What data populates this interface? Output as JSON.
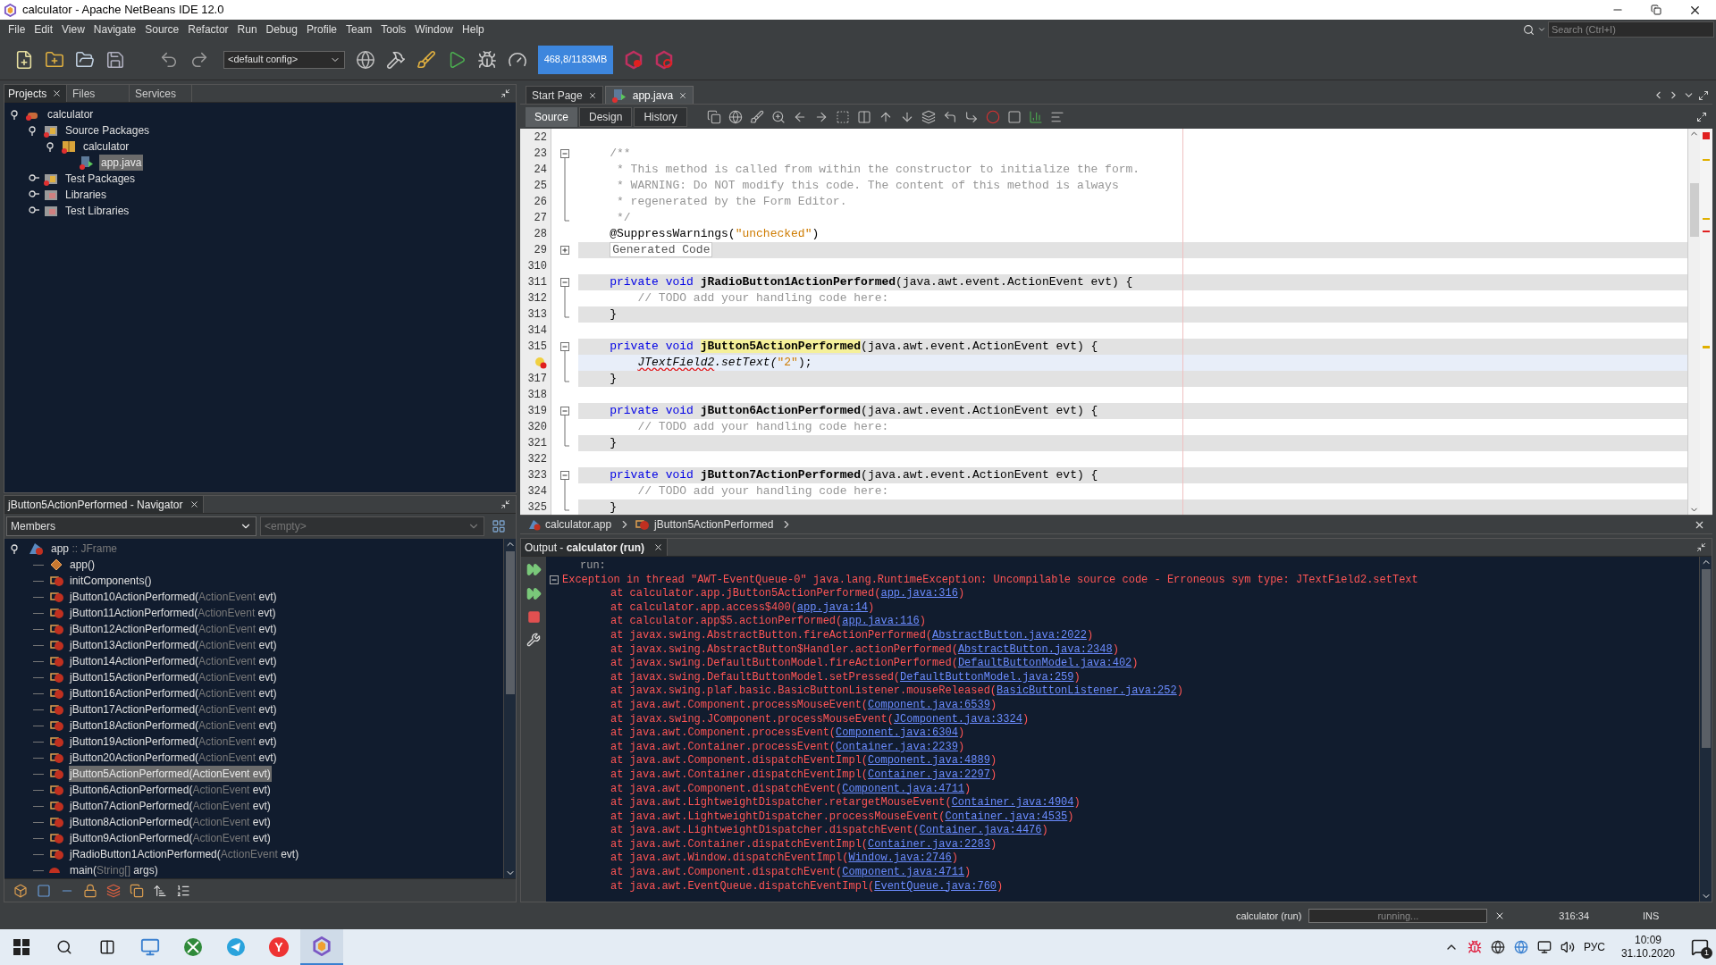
{
  "window": {
    "title": "calculator - Apache NetBeans IDE 12.0"
  },
  "menu": [
    "File",
    "Edit",
    "View",
    "Navigate",
    "Source",
    "Refactor",
    "Run",
    "Debug",
    "Profile",
    "Team",
    "Tools",
    "Window",
    "Help"
  ],
  "search": {
    "placeholder": "Search (Ctrl+I)"
  },
  "toolbar": {
    "config": "<default config>",
    "memory": "468,8/1183MB"
  },
  "projects_panel": {
    "tabs": [
      {
        "label": "Projects",
        "selected": true
      },
      {
        "label": "Files",
        "selected": false
      },
      {
        "label": "Services",
        "selected": false
      }
    ],
    "tree": [
      {
        "label": "calculator",
        "kind": "project",
        "expanded": true,
        "selected": false,
        "children": [
          {
            "label": "Source Packages",
            "kind": "sources",
            "expanded": true,
            "selected": false,
            "children": [
              {
                "label": "calculator",
                "kind": "package",
                "expanded": true,
                "selected": false,
                "children": [
                  {
                    "label": "app.java",
                    "kind": "file",
                    "selected": true
                  }
                ]
              }
            ]
          },
          {
            "label": "Test Packages",
            "kind": "sources",
            "expanded": false,
            "selected": false
          },
          {
            "label": "Libraries",
            "kind": "library",
            "expanded": false,
            "selected": false
          },
          {
            "label": "Test Libraries",
            "kind": "library",
            "expanded": false,
            "selected": false
          }
        ]
      }
    ]
  },
  "navigator": {
    "title": "jButton5ActionPerformed - Navigator",
    "filter": "Members",
    "filter_2": "<empty>",
    "root": {
      "name": "app",
      "type": ":: JFrame",
      "expanded": true,
      "selected": false,
      "children": [
        {
          "kind": "constructor",
          "name": "app()",
          "selected": false
        },
        {
          "kind": "method",
          "name": "initComponents()",
          "selected": false
        },
        {
          "kind": "method",
          "name": "jButton10ActionPerformed(",
          "type": "ActionEvent",
          "tail": " evt)",
          "selected": false
        },
        {
          "kind": "method",
          "name": "jButton11ActionPerformed(",
          "type": "ActionEvent",
          "tail": " evt)",
          "selected": false
        },
        {
          "kind": "method",
          "name": "jButton12ActionPerformed(",
          "type": "ActionEvent",
          "tail": " evt)",
          "selected": false
        },
        {
          "kind": "method",
          "name": "jButton13ActionPerformed(",
          "type": "ActionEvent",
          "tail": " evt)",
          "selected": false
        },
        {
          "kind": "method",
          "name": "jButton14ActionPerformed(",
          "type": "ActionEvent",
          "tail": " evt)",
          "selected": false
        },
        {
          "kind": "method",
          "name": "jButton15ActionPerformed(",
          "type": "ActionEvent",
          "tail": " evt)",
          "selected": false
        },
        {
          "kind": "method",
          "name": "jButton16ActionPerformed(",
          "type": "ActionEvent",
          "tail": " evt)",
          "selected": false
        },
        {
          "kind": "method",
          "name": "jButton17ActionPerformed(",
          "type": "ActionEvent",
          "tail": " evt)",
          "selected": false
        },
        {
          "kind": "method",
          "name": "jButton18ActionPerformed(",
          "type": "ActionEvent",
          "tail": " evt)",
          "selected": false
        },
        {
          "kind": "method",
          "name": "jButton19ActionPerformed(",
          "type": "ActionEvent",
          "tail": " evt)",
          "selected": false
        },
        {
          "kind": "method",
          "name": "jButton20ActionPerformed(",
          "type": "ActionEvent",
          "tail": " evt)",
          "selected": false
        },
        {
          "kind": "method",
          "name": "jButton5ActionPerformed(",
          "type": "ActionEvent",
          "tail": " evt)",
          "selected": true
        },
        {
          "kind": "method",
          "name": "jButton6ActionPerformed(",
          "type": "ActionEvent",
          "tail": " evt)",
          "selected": false
        },
        {
          "kind": "method",
          "name": "jButton7ActionPerformed(",
          "type": "ActionEvent",
          "tail": " evt)",
          "selected": false
        },
        {
          "kind": "method",
          "name": "jButton8ActionPerformed(",
          "type": "ActionEvent",
          "tail": " evt)",
          "selected": false
        },
        {
          "kind": "method",
          "name": "jButton9ActionPerformed(",
          "type": "ActionEvent",
          "tail": " evt)",
          "selected": false
        },
        {
          "kind": "method",
          "name": "jRadioButton1ActionPerformed(",
          "type": "ActionEvent",
          "tail": " evt)",
          "selected": false
        },
        {
          "kind": "main",
          "name": "main(",
          "type": "String[]",
          "tail": " args)",
          "selected": false
        }
      ]
    }
  },
  "editor": {
    "tabs": [
      {
        "label": "Start Page",
        "kind": "page",
        "selected": false
      },
      {
        "label": "app.java",
        "kind": "file",
        "selected": true
      }
    ],
    "views": [
      {
        "label": "Source",
        "selected": true
      },
      {
        "label": "Design",
        "selected": false
      },
      {
        "label": "History",
        "selected": false
      }
    ],
    "lines": [
      {
        "number": "22",
        "kind": "none",
        "shaded": false,
        "current": false,
        "error": false
      },
      {
        "number": "23",
        "kind": "start",
        "shaded": false,
        "current": false,
        "error": false,
        "segments": [
          {
            "kind": "comment",
            "text": "    /**"
          }
        ]
      },
      {
        "number": "24",
        "kind": "body",
        "shaded": false,
        "current": false,
        "error": false,
        "segments": [
          {
            "kind": "comment",
            "text": "     * This method is called from within the constructor to initialize the form."
          }
        ]
      },
      {
        "number": "25",
        "kind": "body",
        "shaded": false,
        "current": false,
        "error": false,
        "segments": [
          {
            "kind": "comment",
            "text": "     * WARNING: Do NOT modify this code. The content of this method is always"
          }
        ]
      },
      {
        "number": "26",
        "kind": "body",
        "shaded": false,
        "current": false,
        "error": false,
        "segments": [
          {
            "kind": "comment",
            "text": "     * regenerated by the Form Editor."
          }
        ]
      },
      {
        "number": "27",
        "kind": "end",
        "shaded": false,
        "current": false,
        "error": false,
        "segments": [
          {
            "kind": "comment",
            "text": "     */"
          }
        ]
      },
      {
        "number": "28",
        "kind": "none",
        "shaded": false,
        "current": false,
        "error": false,
        "segments": [
          {
            "kind": "plain",
            "text": "    @SuppressWarnings("
          },
          {
            "kind": "string",
            "text": "\"unchecked\""
          },
          {
            "kind": "plain",
            "text": ")"
          }
        ]
      },
      {
        "number": "29",
        "kind": "collapsed",
        "shaded": true,
        "current": false,
        "error": false,
        "folded": "Generated Code"
      },
      {
        "number": "310",
        "kind": "none",
        "shaded": false,
        "current": false,
        "error": false
      },
      {
        "number": "311",
        "kind": "start",
        "shaded": true,
        "current": false,
        "error": false,
        "segments": [
          {
            "kind": "keyword",
            "text": "    private void"
          },
          {
            "kind": "method",
            "text": " jRadioButton1ActionPerformed"
          },
          {
            "kind": "plain",
            "text": "(java.awt.event.ActionEvent evt) {"
          }
        ]
      },
      {
        "number": "312",
        "kind": "body",
        "shaded": false,
        "current": false,
        "error": false,
        "segments": [
          {
            "kind": "comment",
            "text": "        // TODO add your handling code here:"
          }
        ]
      },
      {
        "number": "313",
        "kind": "end",
        "shaded": true,
        "current": false,
        "error": false,
        "segments": [
          {
            "kind": "plain",
            "text": "    }"
          }
        ]
      },
      {
        "number": "314",
        "kind": "none",
        "shaded": false,
        "current": false,
        "error": false
      },
      {
        "number": "315",
        "kind": "start",
        "shaded": true,
        "current": false,
        "error": false,
        "segments": [
          {
            "kind": "keyword",
            "text": "    private void"
          },
          {
            "kind": "match",
            "text": " jButton5ActionPerformed"
          },
          {
            "kind": "plain",
            "text": "(java.awt.event.ActionEvent evt) {"
          }
        ]
      },
      {
        "kind": "body",
        "shaded": false,
        "current": true,
        "error": true,
        "segments": [
          {
            "kind": "error",
            "text": "        JTextField2"
          },
          {
            "kind": "italic",
            "text": ".setText("
          },
          {
            "kind": "string",
            "text": "\"2\""
          },
          {
            "kind": "plain",
            "text": ");"
          }
        ]
      },
      {
        "number": "317",
        "kind": "end",
        "shaded": true,
        "current": false,
        "error": false,
        "segments": [
          {
            "kind": "plain",
            "text": "    }"
          }
        ]
      },
      {
        "number": "318",
        "kind": "none",
        "shaded": false,
        "current": false,
        "error": false
      },
      {
        "number": "319",
        "kind": "start",
        "shaded": true,
        "current": false,
        "error": false,
        "segments": [
          {
            "kind": "keyword",
            "text": "    private void"
          },
          {
            "kind": "method",
            "text": " jButton6ActionPerformed"
          },
          {
            "kind": "plain",
            "text": "(java.awt.event.ActionEvent evt) {"
          }
        ]
      },
      {
        "number": "320",
        "kind": "body",
        "shaded": false,
        "current": false,
        "error": false,
        "segments": [
          {
            "kind": "comment",
            "text": "        // TODO add your handling code here:"
          }
        ]
      },
      {
        "number": "321",
        "kind": "end",
        "shaded": true,
        "current": false,
        "error": false,
        "segments": [
          {
            "kind": "plain",
            "text": "    }"
          }
        ]
      },
      {
        "number": "322",
        "kind": "none",
        "shaded": false,
        "current": false,
        "error": false
      },
      {
        "number": "323",
        "kind": "start",
        "shaded": true,
        "current": false,
        "error": false,
        "segments": [
          {
            "kind": "keyword",
            "text": "    private void"
          },
          {
            "kind": "method",
            "text": " jButton7ActionPerformed"
          },
          {
            "kind": "plain",
            "text": "(java.awt.event.ActionEvent evt) {"
          }
        ]
      },
      {
        "number": "324",
        "kind": "body",
        "shaded": false,
        "current": false,
        "error": false,
        "segments": [
          {
            "kind": "comment",
            "text": "        // TODO add your handling code here:"
          }
        ]
      },
      {
        "number": "325",
        "kind": "end",
        "shaded": true,
        "current": false,
        "error": false,
        "segments": [
          {
            "kind": "plain",
            "text": "    }"
          }
        ]
      }
    ],
    "breadcrumbs": [
      {
        "label": "calculator.app",
        "kind": "class"
      },
      {
        "label": "jButton5ActionPerformed",
        "kind": "method"
      }
    ]
  },
  "output": {
    "tab": "Output - **calculator (run)**",
    "lines": [
      {
        "kind": "info",
        "text": "run:"
      },
      {
        "kind": "error",
        "text": "Exception in thread \"AWT-EventQueue-0\" java.lang.RuntimeException: Uncompilable source code - Erroneous sym type: JTextField2.setText"
      },
      {
        "kind": "frame",
        "text": "at calculator.app.jButton5ActionPerformed(",
        "link": "app.java:316",
        "tail": ")"
      },
      {
        "kind": "frame",
        "text": "at calculator.app.access$400(",
        "link": "app.java:14",
        "tail": ")"
      },
      {
        "kind": "frame",
        "text": "at calculator.app$5.actionPerformed(",
        "link": "app.java:116",
        "tail": ")"
      },
      {
        "kind": "frame",
        "text": "at javax.swing.AbstractButton.fireActionPerformed(",
        "link": "AbstractButton.java:2022",
        "tail": ")"
      },
      {
        "kind": "frame",
        "text": "at javax.swing.AbstractButton$Handler.actionPerformed(",
        "link": "AbstractButton.java:2348",
        "tail": ")"
      },
      {
        "kind": "frame",
        "text": "at javax.swing.DefaultButtonModel.fireActionPerformed(",
        "link": "DefaultButtonModel.java:402",
        "tail": ")"
      },
      {
        "kind": "frame",
        "text": "at javax.swing.DefaultButtonModel.setPressed(",
        "link": "DefaultButtonModel.java:259",
        "tail": ")"
      },
      {
        "kind": "frame",
        "text": "at javax.swing.plaf.basic.BasicButtonListener.mouseReleased(",
        "link": "BasicButtonListener.java:252",
        "tail": ")"
      },
      {
        "kind": "frame",
        "text": "at java.awt.Component.processMouseEvent(",
        "link": "Component.java:6539",
        "tail": ")"
      },
      {
        "kind": "frame",
        "text": "at javax.swing.JComponent.processMouseEvent(",
        "link": "JComponent.java:3324",
        "tail": ")"
      },
      {
        "kind": "frame",
        "text": "at java.awt.Component.processEvent(",
        "link": "Component.java:6304",
        "tail": ")"
      },
      {
        "kind": "frame",
        "text": "at java.awt.Container.processEvent(",
        "link": "Container.java:2239",
        "tail": ")"
      },
      {
        "kind": "frame",
        "text": "at java.awt.Component.dispatchEventImpl(",
        "link": "Component.java:4889",
        "tail": ")"
      },
      {
        "kind": "frame",
        "text": "at java.awt.Container.dispatchEventImpl(",
        "link": "Container.java:2297",
        "tail": ")"
      },
      {
        "kind": "frame",
        "text": "at java.awt.Component.dispatchEvent(",
        "link": "Component.java:4711",
        "tail": ")"
      },
      {
        "kind": "frame",
        "text": "at java.awt.LightweightDispatcher.retargetMouseEvent(",
        "link": "Container.java:4904",
        "tail": ")"
      },
      {
        "kind": "frame",
        "text": "at java.awt.LightweightDispatcher.processMouseEvent(",
        "link": "Container.java:4535",
        "tail": ")"
      },
      {
        "kind": "frame",
        "text": "at java.awt.LightweightDispatcher.dispatchEvent(",
        "link": "Container.java:4476",
        "tail": ")"
      },
      {
        "kind": "frame",
        "text": "at java.awt.Container.dispatchEventImpl(",
        "link": "Container.java:2283",
        "tail": ")"
      },
      {
        "kind": "frame",
        "text": "at java.awt.Window.dispatchEventImpl(",
        "link": "Window.java:2746",
        "tail": ")"
      },
      {
        "kind": "frame",
        "text": "at java.awt.Component.dispatchEvent(",
        "link": "Component.java:4711",
        "tail": ")"
      },
      {
        "kind": "frame",
        "text": "at java.awt.EventQueue.dispatchEventImpl(",
        "link": "EventQueue.java:760",
        "tail": ")"
      }
    ]
  },
  "status_bar": {
    "task": "calculator (run)",
    "progress": "running...",
    "level": 0,
    "position": "316:34",
    "mode": "INS"
  },
  "taskbar": {
    "apps": [
      {
        "kind": "explorer",
        "selected": false
      },
      {
        "kind": "xbox",
        "selected": false
      },
      {
        "kind": "telegram",
        "selected": false
      },
      {
        "kind": "yandex",
        "glyph": "Y",
        "selected": false
      },
      {
        "kind": "netbeans",
        "selected": true
      }
    ],
    "language": "РУС",
    "time": "10:09",
    "date": "31.10.2020",
    "notifications": "1"
  }
}
